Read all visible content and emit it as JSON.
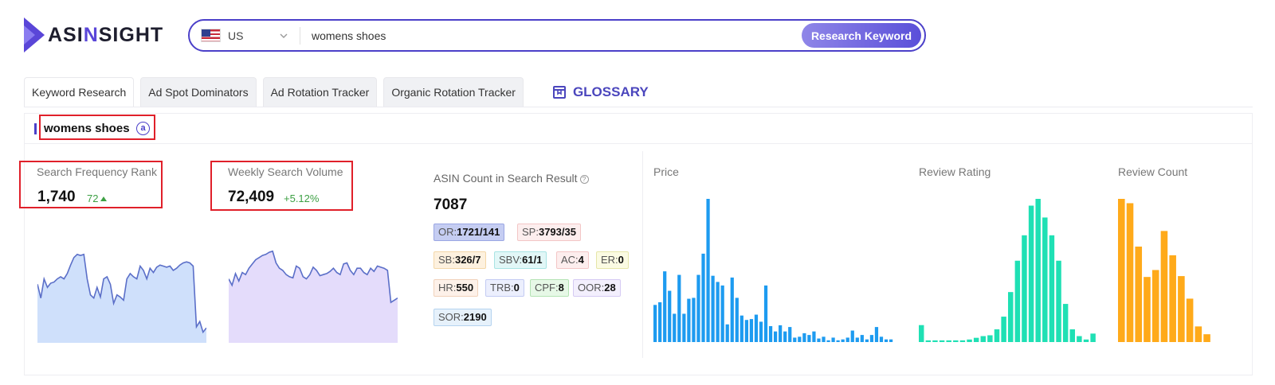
{
  "brand": {
    "pre": "ASI",
    "accent": "N",
    "post": "SIGHT"
  },
  "search": {
    "country": "US",
    "query": "womens shoes",
    "button_label": "Research Keyword"
  },
  "tabs": [
    {
      "label": "Keyword Research",
      "active": true
    },
    {
      "label": "Ad Spot Dominators",
      "active": false
    },
    {
      "label": "Ad Rotation Tracker",
      "active": false
    },
    {
      "label": "Organic Rotation Tracker",
      "active": false
    }
  ],
  "glossary_label": "GLOSSARY",
  "keyword": {
    "title": "womens shoes"
  },
  "metrics": {
    "sfr": {
      "label": "Search Frequency Rank",
      "value": "1,740",
      "delta": "72"
    },
    "wsv": {
      "label": "Weekly Search Volume",
      "value": "72,409",
      "delta": "+5.12%"
    },
    "asin": {
      "label": "ASIN Count in Search Result",
      "value": "7087"
    }
  },
  "badges": [
    {
      "key": "OR:",
      "val": "1721/141"
    },
    {
      "key": "SP:",
      "val": "3793/35"
    },
    {
      "key": "SB:",
      "val": "326/7"
    },
    {
      "key": "SBV:",
      "val": "61/1"
    },
    {
      "key": "AC:",
      "val": "4"
    },
    {
      "key": "ER:",
      "val": "0"
    },
    {
      "key": "HR:",
      "val": "550"
    },
    {
      "key": "TRB:",
      "val": "0"
    },
    {
      "key": "CPF:",
      "val": "8"
    },
    {
      "key": "OOR:",
      "val": "28"
    },
    {
      "key": "SOR:",
      "val": "2190"
    }
  ],
  "colors": {
    "accent": "#4b40c9",
    "price_bar": "#1d9bf0",
    "rating_bar": "#1fe0b4",
    "count_bar": "#ffaa1a",
    "sfr_area": "#cfe0fb",
    "wsv_area": "#e4dcfb",
    "line": "#5b6fc8",
    "highlight": "#e0202a"
  },
  "chart_data": [
    {
      "type": "area",
      "series": [
        {
          "values": [
            45,
            58,
            40,
            48,
            44,
            43,
            40,
            38,
            40,
            35,
            27,
            20,
            17,
            18,
            17,
            40,
            55,
            58,
            48,
            57,
            40,
            38,
            45,
            63,
            55,
            57,
            60,
            40,
            35,
            38,
            40,
            28,
            32,
            40,
            30,
            34,
            29,
            27,
            28,
            29,
            28,
            32,
            30,
            27,
            25,
            24,
            25,
            28,
            85,
            80,
            90,
            86
          ]
        }
      ]
    },
    {
      "type": "area",
      "series": [
        {
          "values": [
            40,
            46,
            35,
            42,
            34,
            36,
            30,
            26,
            22,
            20,
            18,
            17,
            15,
            14,
            25,
            30,
            32,
            36,
            38,
            39,
            28,
            30,
            38,
            40,
            36,
            29,
            32,
            37,
            36,
            35,
            33,
            30,
            34,
            36,
            26,
            25,
            32,
            36,
            30,
            30,
            34,
            36,
            30,
            33,
            28,
            29,
            30,
            32,
            62,
            60,
            58
          ]
        }
      ]
    },
    {
      "type": "bar",
      "title": "Price",
      "values": [
        42,
        45,
        80,
        58,
        32,
        76,
        32,
        49,
        50,
        76,
        100,
        162,
        75,
        68,
        64,
        20,
        73,
        50,
        30,
        25,
        26,
        31,
        23,
        64,
        18,
        12,
        19,
        12,
        17,
        5,
        6,
        10,
        8,
        12,
        4,
        6,
        2,
        5,
        2,
        3,
        5,
        13,
        5,
        8,
        3,
        8,
        17,
        6,
        3,
        3
      ]
    },
    {
      "type": "bar",
      "title": "Review Rating",
      "values": [
        20,
        2,
        2,
        2,
        2,
        2,
        2,
        3,
        5,
        7,
        8,
        15,
        30,
        59,
        96,
        126,
        161,
        169,
        147,
        126,
        96,
        45,
        15,
        7,
        3,
        10
      ]
    },
    {
      "type": "bar",
      "title": "Review Count",
      "values": [
        165,
        160,
        110,
        75,
        83,
        128,
        100,
        76,
        50,
        18,
        9
      ]
    }
  ]
}
